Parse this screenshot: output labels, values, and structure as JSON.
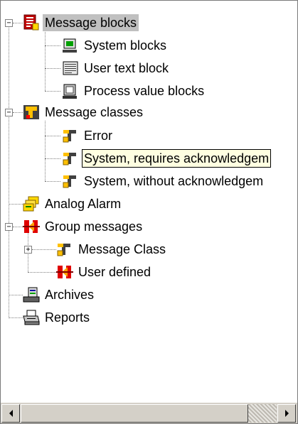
{
  "tree": {
    "message_blocks": {
      "label": "Message blocks",
      "expanded": true
    },
    "system_blocks": {
      "label": "System blocks"
    },
    "user_text_block": {
      "label": "User text block"
    },
    "process_value_blocks": {
      "label": "Process value blocks"
    },
    "message_classes": {
      "label": "Message classes",
      "expanded": true
    },
    "error": {
      "label": "Error"
    },
    "system_requires_ack": {
      "label": "System, requires acknowledgem"
    },
    "system_without_ack": {
      "label": "System, without acknowledgem"
    },
    "analog_alarm": {
      "label": "Analog Alarm"
    },
    "group_messages": {
      "label": "Group messages",
      "expanded": true
    },
    "message_class": {
      "label": "Message Class",
      "expanded": false
    },
    "user_defined": {
      "label": "User defined"
    },
    "archives": {
      "label": "Archives"
    },
    "reports": {
      "label": "Reports"
    }
  },
  "icons": {
    "message_blocks": "message-blocks-icon",
    "system_blocks": "system-block-icon",
    "user_text_block": "text-block-icon",
    "process_value_blocks": "process-value-icon",
    "message_classes": "message-class-icon",
    "analog_alarm": "analog-alarm-icon",
    "group_messages": "group-messages-icon",
    "archives": "archive-icon",
    "reports": "printer-icon"
  },
  "scrollbar": {
    "left_arrow": "◀",
    "right_arrow": "▶"
  },
  "colors": {
    "selection": "#c0c0c0",
    "focus_bg": "#ffffe1",
    "scrollbar": "#d4d0c8"
  }
}
